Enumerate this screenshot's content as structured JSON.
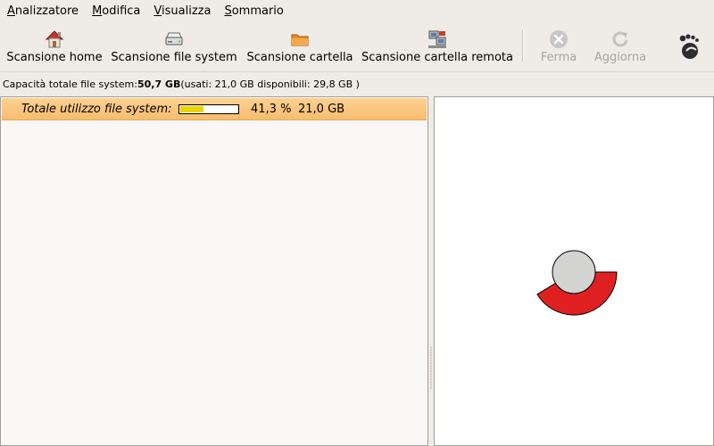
{
  "menubar": {
    "items": [
      {
        "mnemonic": "A",
        "rest": "nalizzatore"
      },
      {
        "mnemonic": "M",
        "rest": "odifica"
      },
      {
        "mnemonic": "V",
        "rest": "isualizza"
      },
      {
        "mnemonic": "S",
        "rest": "ommario"
      }
    ]
  },
  "toolbar": {
    "scan_home": "Scansione home",
    "scan_fs": "Scansione file system",
    "scan_folder": "Scansione cartella",
    "scan_remote": "Scansione cartella remota",
    "stop": "Ferma",
    "refresh": "Aggiorna"
  },
  "capacity": {
    "label": "Capacità totale file system:",
    "total": "50,7 GB",
    "detail": "(usati: 21,0 GB disponibili: 29,8 GB )"
  },
  "tree": {
    "total_label": "Totale utilizzo file system:",
    "usage_percent": 41.3,
    "percent_text": "41,3 %",
    "size_text": "21,0 GB"
  },
  "icons": {
    "scan_home": "home-icon",
    "scan_fs": "drive-icon",
    "scan_folder": "folder-icon",
    "scan_remote": "network-icon",
    "stop": "stop-icon",
    "refresh": "refresh-icon",
    "gnome": "gnome-foot-icon"
  },
  "colors": {
    "selected_row": "#f8bd6e",
    "usage_fill": "#e9d400",
    "ring_segment": "#e02020",
    "ring_center": "#d3d3d1"
  }
}
